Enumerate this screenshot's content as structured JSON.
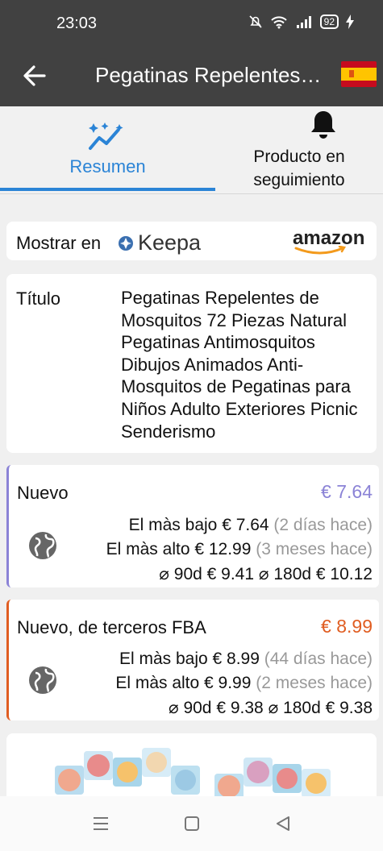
{
  "status_bar": {
    "time": "23:03",
    "battery": "92"
  },
  "app_bar": {
    "title": "Pegatinas Repelentes…",
    "back_icon": "arrow-left-icon",
    "flag_icon": "spain-flag-icon"
  },
  "tabs": [
    {
      "label": "Resumen",
      "icon": "chart-sparkle-icon",
      "active": true
    },
    {
      "label_line1": "Producto en",
      "label_line2": "seguimiento",
      "icon": "bell-icon",
      "active": false
    }
  ],
  "show_on": {
    "label": "Mostrar en",
    "keepa": "Keepa",
    "amazon": "amazon"
  },
  "title_card": {
    "label": "Título",
    "value": "Pegatinas Repelentes de Mosquitos 72 Piezas Natural Pegatinas Antimosquitos Dibujos Animados Anti-Mosquitos de Pegatinas para Niños Adulto Exteriores Picnic Senderismo"
  },
  "new": {
    "name": "Nuevo",
    "price": "€ 7.64",
    "lowest_label": "El màs bajo",
    "lowest_value": "€ 7.64",
    "lowest_when": "(2 días hace)",
    "highest_label": "El màs alto",
    "highest_value": "€ 12.99",
    "highest_when": "(3 meses hace)",
    "avg90_label": "⌀ 90d",
    "avg90_value": "€ 9.41",
    "avg180_label": "⌀ 180d",
    "avg180_value": "€ 10.12",
    "color": "#8b83d6"
  },
  "fba": {
    "name": "Nuevo, de terceros FBA",
    "price": "€ 8.99",
    "lowest_label": "El màs bajo",
    "lowest_value": "€ 8.99",
    "lowest_when": "(44 días hace)",
    "highest_label": "El màs alto",
    "highest_value": "€ 9.99",
    "highest_when": "(2 meses hace)",
    "avg90_label": "⌀ 90d",
    "avg90_value": "€ 9.38",
    "avg180_label": "⌀ 180d",
    "avg180_value": "€ 9.38",
    "color": "#e05d21"
  },
  "nav": {
    "menu_icon": "menu-icon",
    "home_icon": "home-icon",
    "back_icon": "back-triangle-icon"
  }
}
